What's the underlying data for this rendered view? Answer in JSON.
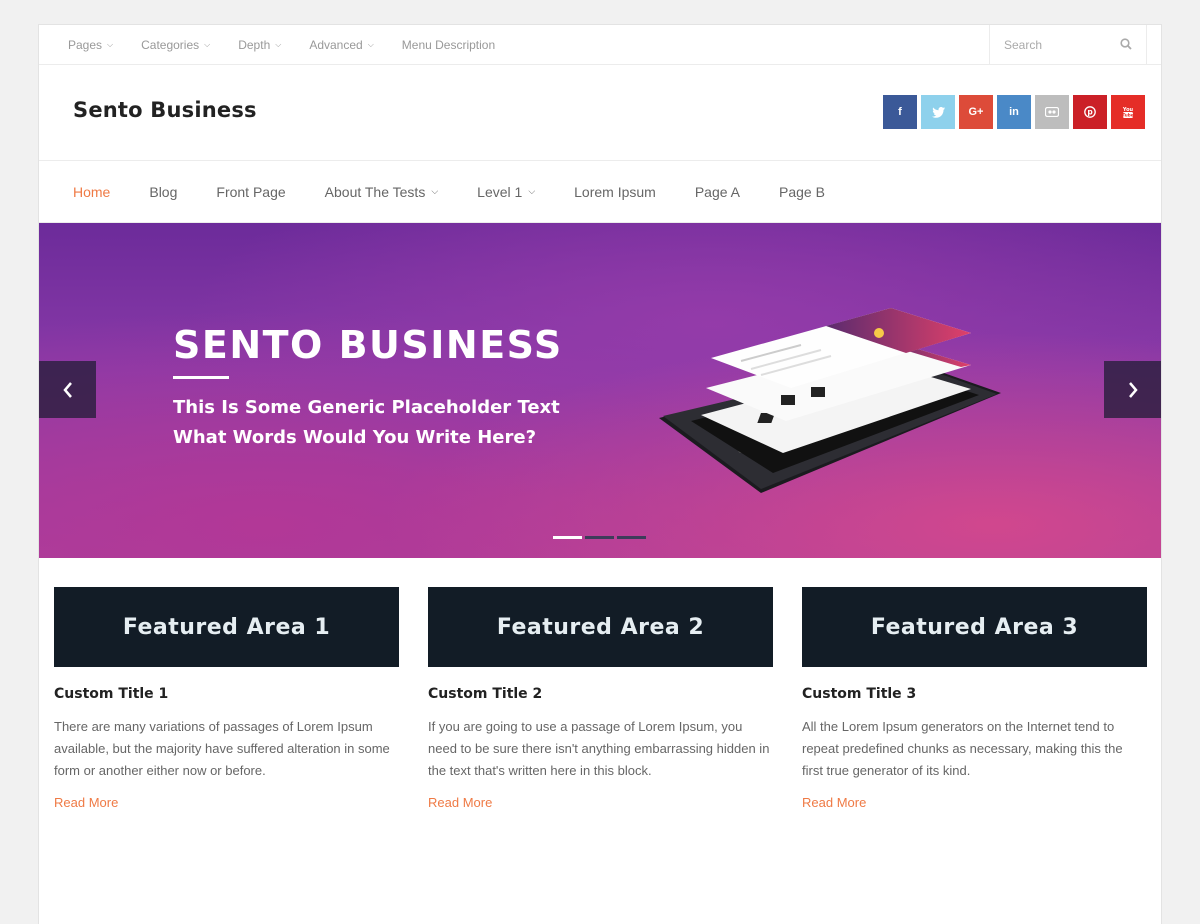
{
  "topnav": {
    "items": [
      {
        "label": "Pages",
        "dropdown": true
      },
      {
        "label": "Categories",
        "dropdown": true
      },
      {
        "label": "Depth",
        "dropdown": true
      },
      {
        "label": "Advanced",
        "dropdown": true
      },
      {
        "label": "Menu Description",
        "dropdown": false
      }
    ],
    "search_placeholder": "Search"
  },
  "header": {
    "site_title": "Sento Business",
    "social": [
      {
        "name": "facebook",
        "glyph": "f",
        "color": "#3b5998"
      },
      {
        "name": "twitter",
        "glyph": "t",
        "color": "#8ed1ec"
      },
      {
        "name": "google-plus",
        "glyph": "G+",
        "color": "#dd4b39"
      },
      {
        "name": "linkedin",
        "glyph": "in",
        "color": "#4a89c7"
      },
      {
        "name": "flickr",
        "glyph": "••",
        "color": "#bdbdbd"
      },
      {
        "name": "pinterest",
        "glyph": "P",
        "color": "#cb2027"
      },
      {
        "name": "youtube",
        "glyph": "▶",
        "color": "#e52d27"
      }
    ]
  },
  "mainnav": {
    "items": [
      {
        "label": "Home",
        "active": true,
        "dropdown": false
      },
      {
        "label": "Blog",
        "active": false,
        "dropdown": false
      },
      {
        "label": "Front Page",
        "active": false,
        "dropdown": false
      },
      {
        "label": "About The Tests",
        "active": false,
        "dropdown": true
      },
      {
        "label": "Level 1",
        "active": false,
        "dropdown": true
      },
      {
        "label": "Lorem Ipsum",
        "active": false,
        "dropdown": false
      },
      {
        "label": "Page A",
        "active": false,
        "dropdown": false
      },
      {
        "label": "Page B",
        "active": false,
        "dropdown": false
      }
    ],
    "accent": "#ef7a45"
  },
  "hero": {
    "title": "SENTO BUSINESS",
    "subtitle_line1": "This Is Some Generic Placeholder Text",
    "subtitle_line2": "What Words Would You Write Here?",
    "slides": 3,
    "active_slide": 1
  },
  "features": [
    {
      "banner": "Featured Area 1",
      "title": "Custom Title 1",
      "text": "There are many variations of passages of Lorem Ipsum available, but the majority have suffered alteration in some form or another either now or before.",
      "link": "Read More"
    },
    {
      "banner": "Featured Area 2",
      "title": "Custom Title 2",
      "text": "If you are going to use a passage of Lorem Ipsum, you need to be sure there isn't anything embarrassing hidden in the text that's written here in this block.",
      "link": "Read More"
    },
    {
      "banner": "Featured Area 3",
      "title": "Custom Title 3",
      "text": "All the Lorem Ipsum generators on the Internet tend to repeat predefined chunks as necessary, making this the first true generator of its kind.",
      "link": "Read More"
    }
  ]
}
